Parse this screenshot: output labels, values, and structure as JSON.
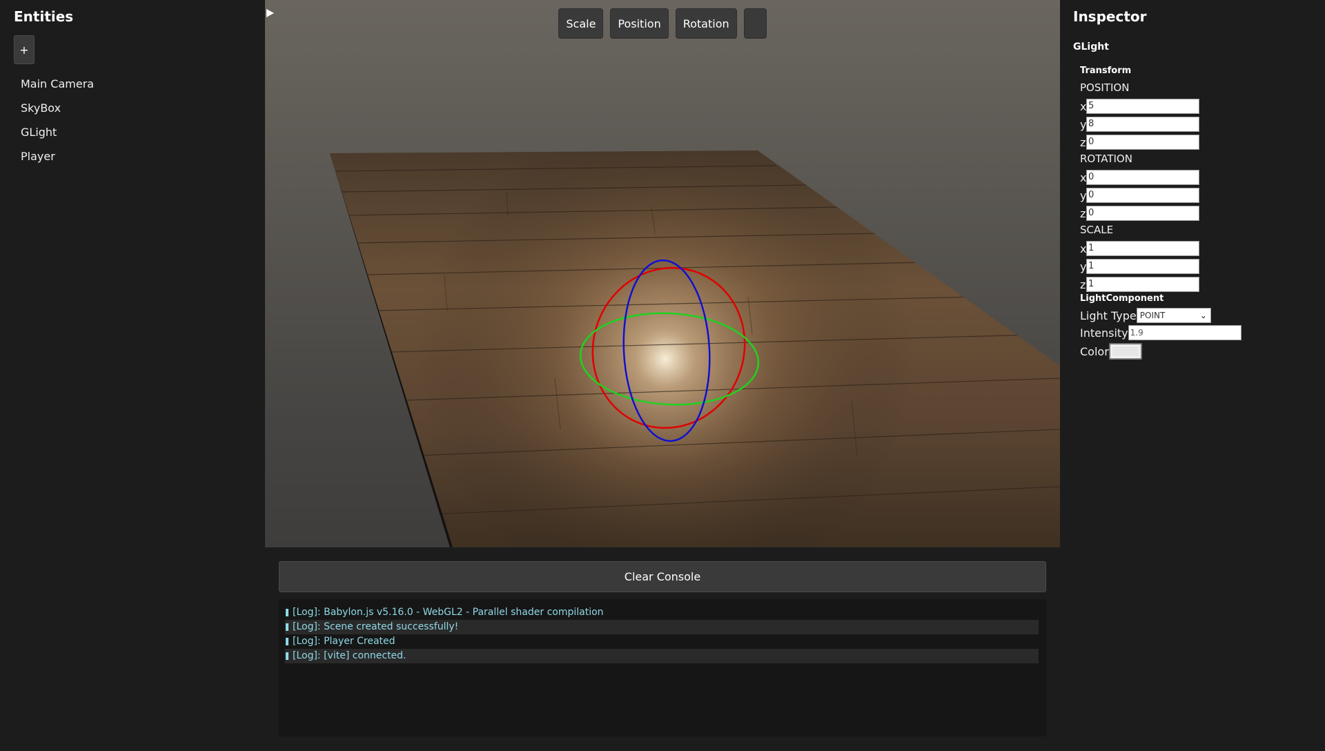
{
  "entities_panel": {
    "title": "Entities",
    "add_label": "+",
    "items": [
      "Main Camera",
      "SkyBox",
      "GLight",
      "Player"
    ]
  },
  "toolbar": {
    "scale_label": "Scale",
    "position_label": "Position",
    "rotation_label": "Rotation",
    "play_icon": "play-icon"
  },
  "inspector": {
    "title": "Inspector",
    "entity_name": "GLight",
    "transform_label": "Transform",
    "position_label": "POSITION",
    "position": {
      "x": "5",
      "y": "8",
      "z": "0"
    },
    "rotation_label": "ROTATION",
    "rotation": {
      "x": "0",
      "y": "0",
      "z": "0"
    },
    "scale_label": "SCALE",
    "scale": {
      "x": "1",
      "y": "1",
      "z": "1"
    },
    "light_component_label": "LightComponent",
    "light_type_label": "Light Type",
    "light_type_value": "POINT",
    "intensity_label": "Intensity",
    "intensity_value": "1.9",
    "color_label": "Color",
    "color_value": "#e6e6e6"
  },
  "console": {
    "clear_label": "Clear Console",
    "logs": [
      "[Log]: Babylon.js v5.16.0 - WebGL2 - Parallel shader compilation",
      "[Log]: Scene created successfully!",
      "[Log]: Player Created",
      "[Log]: [vite] connected."
    ]
  },
  "colors": {
    "gizmo_x": "#ff0000",
    "gizmo_y": "#00cc00",
    "gizmo_z": "#0000ff",
    "console_text": "#8fd9e6"
  }
}
